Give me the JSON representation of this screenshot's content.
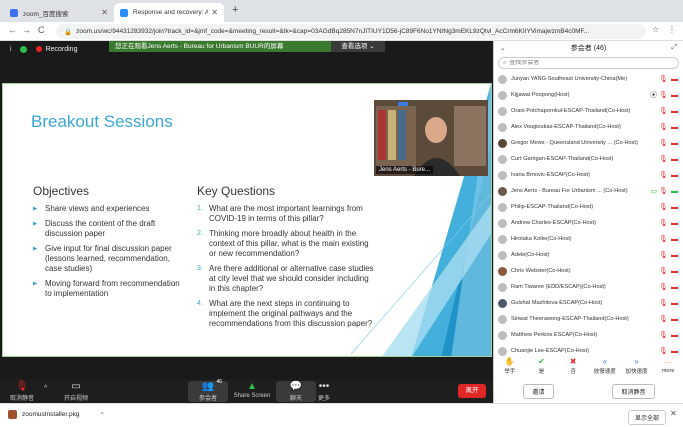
{
  "browser": {
    "tabs": [
      {
        "title": "zoom_百度搜索",
        "favicon_color": "#3d6ff0",
        "active": false
      },
      {
        "title": "Response and recovery: A",
        "favicon_color": "#2d8cff",
        "active": true
      }
    ],
    "new_tab": "+",
    "nav": {
      "back": "←",
      "forward": "→",
      "reload": "C"
    },
    "url": "zoom.us/wc/94431283932/join?track_id=&jmf_code=&meeting_result=&tk=&cap=03AGdBq285N7nJITIUY1D56-jC89F6No1YNtNg3mEKL9zQtvl_AcCrm6KIIYVimajwzmB4c0MF...",
    "lock": "🔒",
    "right_icons": [
      "☆",
      "⋮"
    ]
  },
  "meeting": {
    "info_icon": "i",
    "recording_label": "Recording",
    "share_banner": "您正在观看Jens Aerts - Bureau for Urbanism BUUR的屏幕",
    "view_options": "查看选项 ⌄",
    "slide": {
      "title": "Breakout Sessions",
      "objectives_heading": "Objectives",
      "objectives": [
        "Share views and experiences",
        "Discuss the content of the draft discussion paper",
        "Give input for final discussion paper (lessons learned, recommendation, case studies)",
        "Moving forward from recommendation to implementation"
      ],
      "questions_heading": "Key Questions",
      "questions": [
        {
          "n": "1.",
          "text": "What are the most important learnings from COVID-19 in terms of this pillar?"
        },
        {
          "n": "2.",
          "text": "Thinking more broadly about health in the context of this pillar, what is the main existing or new recommendation?"
        },
        {
          "n": "3.",
          "text": "Are there additional or alternative case studies at city level that we should consider including in this chapter?"
        },
        {
          "n": "4.",
          "text": "What are the next steps in continuing to implement the original pathways and the recommendations from this discussion paper?"
        }
      ]
    },
    "speaker_name": "Jens Aerts - Bure...",
    "toolbar": {
      "mute": "取消静音",
      "video": "开启视频",
      "participants": "参会者",
      "participants_count": "46",
      "share": "Share Screen",
      "chat": "聊天",
      "more": "更多",
      "leave": "离开"
    }
  },
  "panel": {
    "title": "参会者 (46)",
    "search_placeholder": "查找参会者",
    "participants": [
      {
        "name": "Junyan YANG-Southeast University-China(Me)",
        "avatar_color": "#bdbdbd",
        "icon": ""
      },
      {
        "name": "Kijjawat Poopong(Host)",
        "avatar_color": "#bdbdbd",
        "icon": "rec"
      },
      {
        "name": "Orani Potchapornkul-ESCAP-Thailand(Co-Host)",
        "avatar_color": "#bdbdbd",
        "icon": ""
      },
      {
        "name": "Alex Vougioukas-ESCAP-Thailand(Co-Host)",
        "avatar_color": "#bdbdbd",
        "icon": ""
      },
      {
        "name": "Gregor Mews - Queensland University ... (Co-Host)",
        "avatar_color": "#5b4636",
        "icon": ""
      },
      {
        "name": "Curt Garrigan-ESCAP-Thailand(Co-Host)",
        "avatar_color": "#bdbdbd",
        "icon": ""
      },
      {
        "name": "Ivana Brnovic-ESCAP(Co-Host)",
        "avatar_color": "#bdbdbd",
        "icon": ""
      },
      {
        "name": "Jens Aerts - Bureau For Urbanism ... (Co-Host)",
        "avatar_color": "#6b5a4a",
        "icon": "screen"
      },
      {
        "name": "Philip-ESCAP-Thailand(Co-Host)",
        "avatar_color": "#bdbdbd",
        "icon": ""
      },
      {
        "name": "Andrew Charles-ESCAP(Co-Host)",
        "avatar_color": "#bdbdbd",
        "icon": ""
      },
      {
        "name": "Hirotaka Koike(Co-Host)",
        "avatar_color": "#bdbdbd",
        "icon": ""
      },
      {
        "name": "Adele(Co-Host)",
        "avatar_color": "#bdbdbd",
        "icon": ""
      },
      {
        "name": "Chris Webster(Co-Host)",
        "avatar_color": "#8a5a3a",
        "icon": ""
      },
      {
        "name": "Ram Tiwaree (EDD/ESCAP)(Co-Host)",
        "avatar_color": "#bdbdbd",
        "icon": ""
      },
      {
        "name": "Gulshat Mazhitova-ESCAP(Co-Host)",
        "avatar_color": "#4a5a6a",
        "icon": ""
      },
      {
        "name": "Siriwat Theerawong-ESCAP-Thailand(Co-Host)",
        "avatar_color": "#bdbdbd",
        "icon": ""
      },
      {
        "name": "Matthew Perkins ESCAP(Co-Host)",
        "avatar_color": "#bdbdbd",
        "icon": ""
      },
      {
        "name": "Chuanjie Lee-ESCAP(Co-Host)",
        "avatar_color": "#bdbdbd",
        "icon": ""
      }
    ],
    "actions": [
      {
        "label": "举手",
        "glyph": "✋",
        "tone": ""
      },
      {
        "label": "是",
        "glyph": "✔",
        "tone": "g"
      },
      {
        "label": "否",
        "glyph": "✖",
        "tone": "r"
      },
      {
        "label": "放慢速度",
        "glyph": "«",
        "tone": "b"
      },
      {
        "label": "加快速度",
        "glyph": "»",
        "tone": "b"
      },
      {
        "label": "more",
        "glyph": "⋯",
        "tone": ""
      }
    ],
    "invite": "邀请",
    "unmute_me": "取消静音"
  },
  "downloads": {
    "filename": "zoomusInstaller.pkg",
    "show_all": "显示全部",
    "close": "✕"
  }
}
